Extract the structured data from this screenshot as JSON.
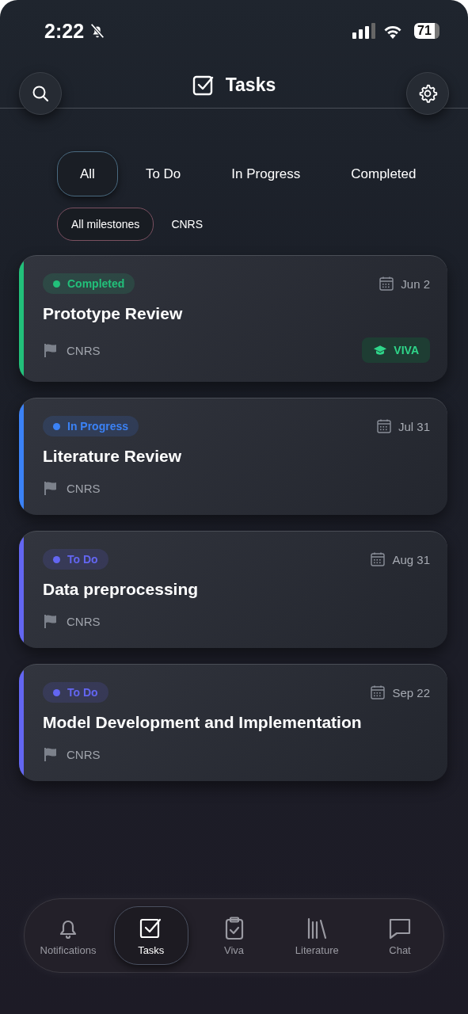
{
  "status_bar": {
    "time": "2:22",
    "battery": "71"
  },
  "header": {
    "title": "Tasks"
  },
  "filter_tabs": [
    {
      "label": "All",
      "selected": true
    },
    {
      "label": "To Do",
      "selected": false
    },
    {
      "label": "In Progress",
      "selected": false
    },
    {
      "label": "Completed",
      "selected": false
    }
  ],
  "milestone_chips": [
    {
      "label": "All milestones",
      "selected": true
    },
    {
      "label": "CNRS",
      "selected": false
    }
  ],
  "tasks": [
    {
      "status": "Completed",
      "color": "#22c07a",
      "date": "Jun 2",
      "title": "Prototype Review",
      "milestone": "CNRS",
      "badge": "VIVA"
    },
    {
      "status": "In Progress",
      "color": "#3b82f6",
      "date": "Jul 31",
      "title": "Literature Review",
      "milestone": "CNRS"
    },
    {
      "status": "To Do",
      "color": "#6366f1",
      "date": "Aug 31",
      "title": "Data preprocessing",
      "milestone": "CNRS"
    },
    {
      "status": "To Do",
      "color": "#6366f1",
      "date": "Sep 22",
      "title": "Model Development and Implementation",
      "milestone": "CNRS"
    }
  ],
  "nav": [
    {
      "label": "Notifications",
      "selected": false
    },
    {
      "label": "Tasks",
      "selected": true
    },
    {
      "label": "Viva",
      "selected": false
    },
    {
      "label": "Literature",
      "selected": false
    },
    {
      "label": "Chat",
      "selected": false
    }
  ]
}
